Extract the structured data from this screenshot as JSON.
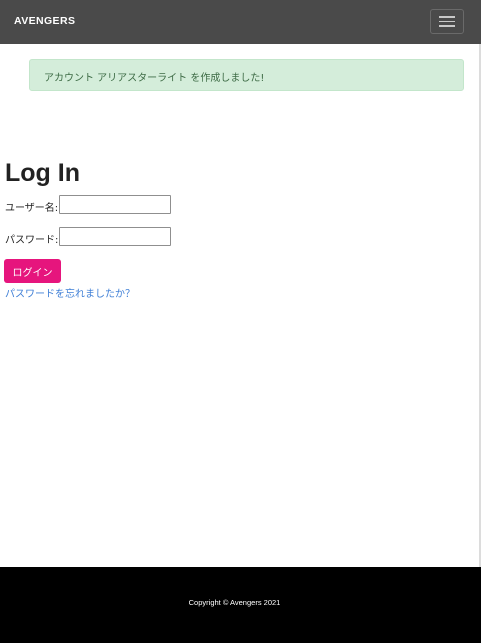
{
  "navbar": {
    "brand": "AVENGERS",
    "toggler_icon": "hamburger-menu-icon"
  },
  "alert": {
    "message": "アカウント アリアスターライト を作成しました!",
    "color": "#d4edda"
  },
  "login": {
    "title": "Log In",
    "username_label": "ユーザー名:",
    "username_value": "",
    "password_label": "パスワード:",
    "password_value": "",
    "submit_label": "ログイン",
    "forgot_link": "パスワードを忘れましたか？"
  },
  "footer": {
    "copyright": "Copyright © Avengers 2021"
  },
  "colors": {
    "navbar_bg": "#4a4a4a",
    "accent_button": "#e6157d",
    "link": "#3f7fd6",
    "footer_bg": "#000000"
  }
}
